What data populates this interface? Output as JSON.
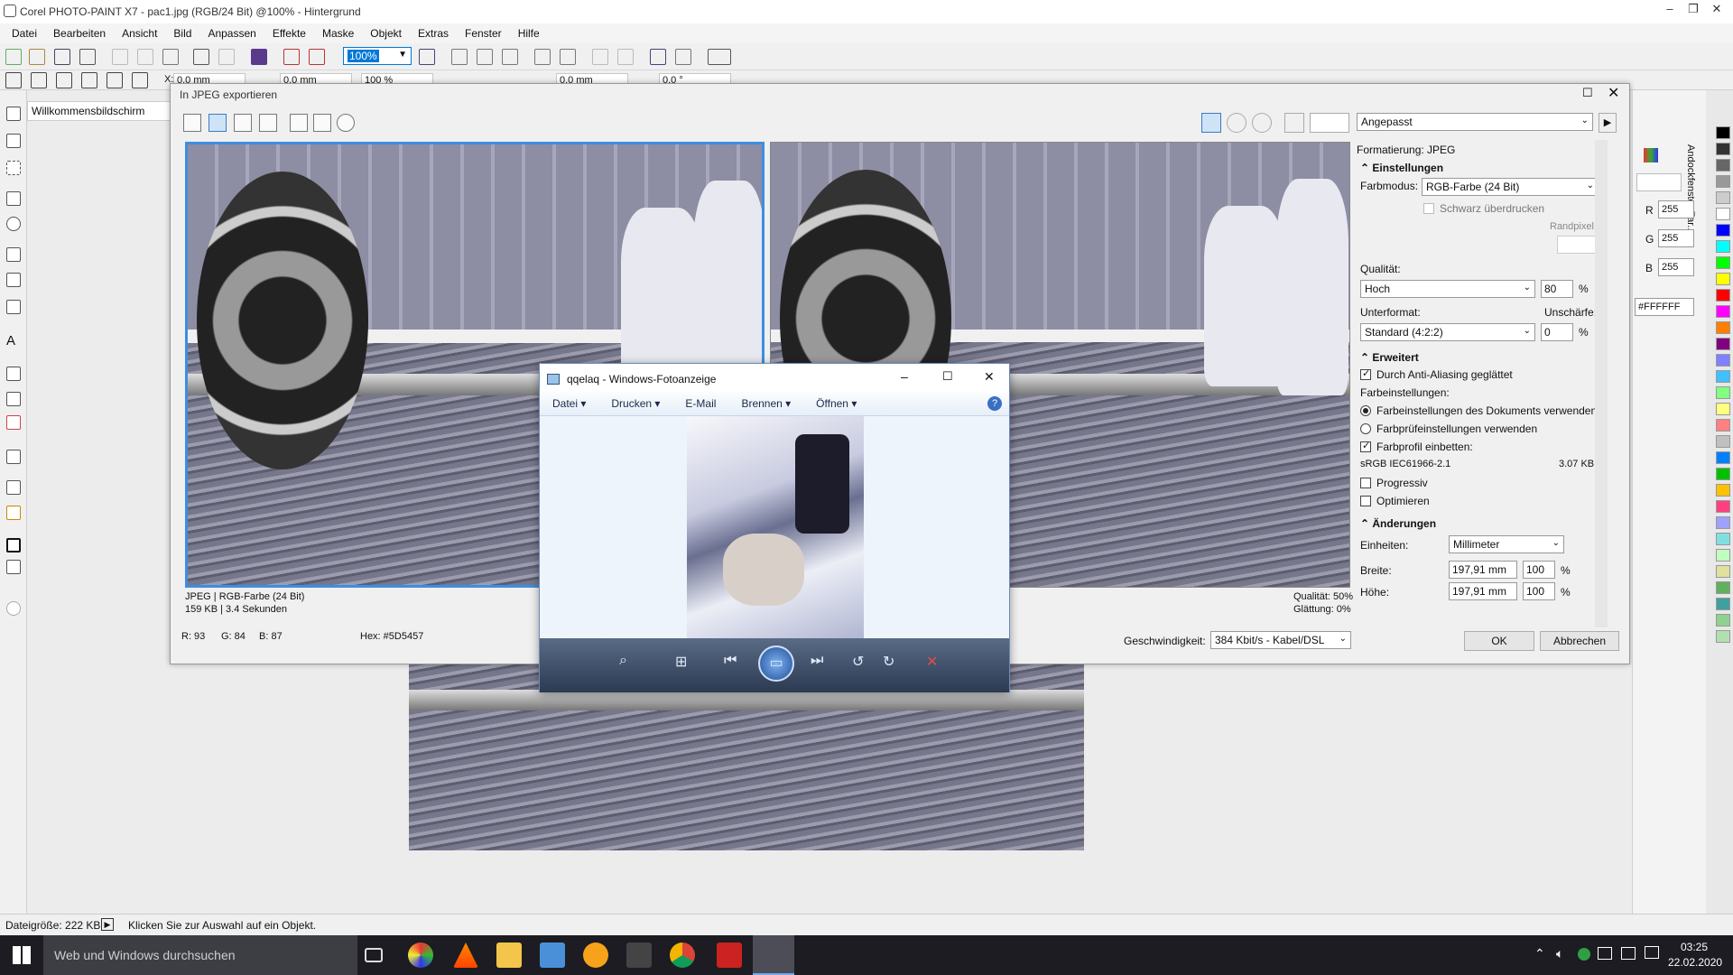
{
  "window": {
    "title": "Corel PHOTO-PAINT X7 - pac1.jpg (RGB/24 Bit) @100% - Hintergrund"
  },
  "menu": [
    "Datei",
    "Bearbeiten",
    "Ansicht",
    "Bild",
    "Anpassen",
    "Effekte",
    "Maske",
    "Objekt",
    "Extras",
    "Fenster",
    "Hilfe"
  ],
  "toolbar": {
    "zoom": "100%"
  },
  "propbar": {
    "x": "0,0 mm",
    "y": "0,0 mm",
    "scale": "100 %",
    "w": "0,0 mm",
    "angle": "0,0 °",
    "x_label": "X:"
  },
  "welcome_tab": "Willkommensbildschirm",
  "export_dialog": {
    "title": "In JPEG exportieren",
    "preset": "Angepasst",
    "left_info_line1": "JPEG  |  RGB-Farbe (24 Bit)",
    "left_info_line2": "159 KB  |  3.4 Sekunden",
    "right_info_line1": "Qualität: 50%",
    "right_info_line2": "Glättung: 0%",
    "pixel_r": "R: 93",
    "pixel_g": "G: 84",
    "pixel_b": "B: 87",
    "pixel_hex": "Hex: #5D5457",
    "speed_label": "Geschwindigkeit:",
    "speed_value": "384 Kbit/s - Kabel/DSL",
    "ok": "OK",
    "cancel": "Abbrechen",
    "panel": {
      "format": "Formatierung: JPEG",
      "settings_header": "Einstellungen",
      "color_mode_label": "Farbmodus:",
      "color_mode": "RGB-Farbe (24 Bit)",
      "overprint": "Schwarz überdrucken",
      "border_pixel": "Randpixel:",
      "quality_label": "Qualität:",
      "quality": "Hoch",
      "quality_value": "80",
      "percent": "%",
      "subformat_label": "Unterformat:",
      "subformat": "Standard (4:2:2)",
      "blur_label": "Unschärfe:",
      "blur_value": "0",
      "advanced_header": "Erweitert",
      "antialias": "Durch Anti-Aliasing geglättet",
      "color_settings": "Farbeinstellungen:",
      "opt_doc": "Farbeinstellungen des Dokuments verwenden",
      "opt_proof": "Farbprüfeinstellungen verwenden",
      "embed": "Farbprofil einbetten:",
      "profile": "sRGB IEC61966-2.1",
      "profile_size": "3.07 KB",
      "progressive": "Progressiv",
      "optimize": "Optimieren",
      "changes_header": "Änderungen",
      "units_label": "Einheiten:",
      "units": "Millimeter",
      "width_label": "Breite:",
      "width": "197,91 mm",
      "width_pct": "100",
      "height_label": "Höhe:",
      "height": "197,91 mm",
      "height_pct": "100"
    }
  },
  "photo_viewer": {
    "title": "qqelaq - Windows-Fotoanzeige",
    "menu": [
      "Datei ▾",
      "Drucken ▾",
      "E-Mail",
      "Brennen ▾",
      "Öffnen ▾"
    ]
  },
  "color_docker": {
    "r_label": "R",
    "r": "255",
    "g_label": "G",
    "g": "255",
    "b_label": "B",
    "b": "255",
    "hex": "#FFFFFF",
    "title": "Andockfenster Far..."
  },
  "statusbar": {
    "filesize": "Dateigröße: 222 KB",
    "hint": "Klicken Sie zur Auswahl auf ein Objekt."
  },
  "taskbar": {
    "search": "Web und Windows durchsuchen",
    "time": "03:25",
    "date": "22.02.2020"
  },
  "palette_colors": [
    "#000000",
    "#333333",
    "#666666",
    "#999999",
    "#cccccc",
    "#ffffff",
    "#0000ff",
    "#00ffff",
    "#00ff00",
    "#ffff00",
    "#ff0000",
    "#ff00ff",
    "#ff8000",
    "#800080",
    "#8080ff",
    "#40c0ff",
    "#80ff80",
    "#ffff80",
    "#ff8080",
    "#c0c0c0",
    "#0080ff",
    "#00c000",
    "#ffc000",
    "#ff4080",
    "#a0a0ff",
    "#80e0e0",
    "#c0ffc0",
    "#e0e0a0",
    "#60b060",
    "#40a0a0",
    "#90d090",
    "#b0e0b0"
  ]
}
